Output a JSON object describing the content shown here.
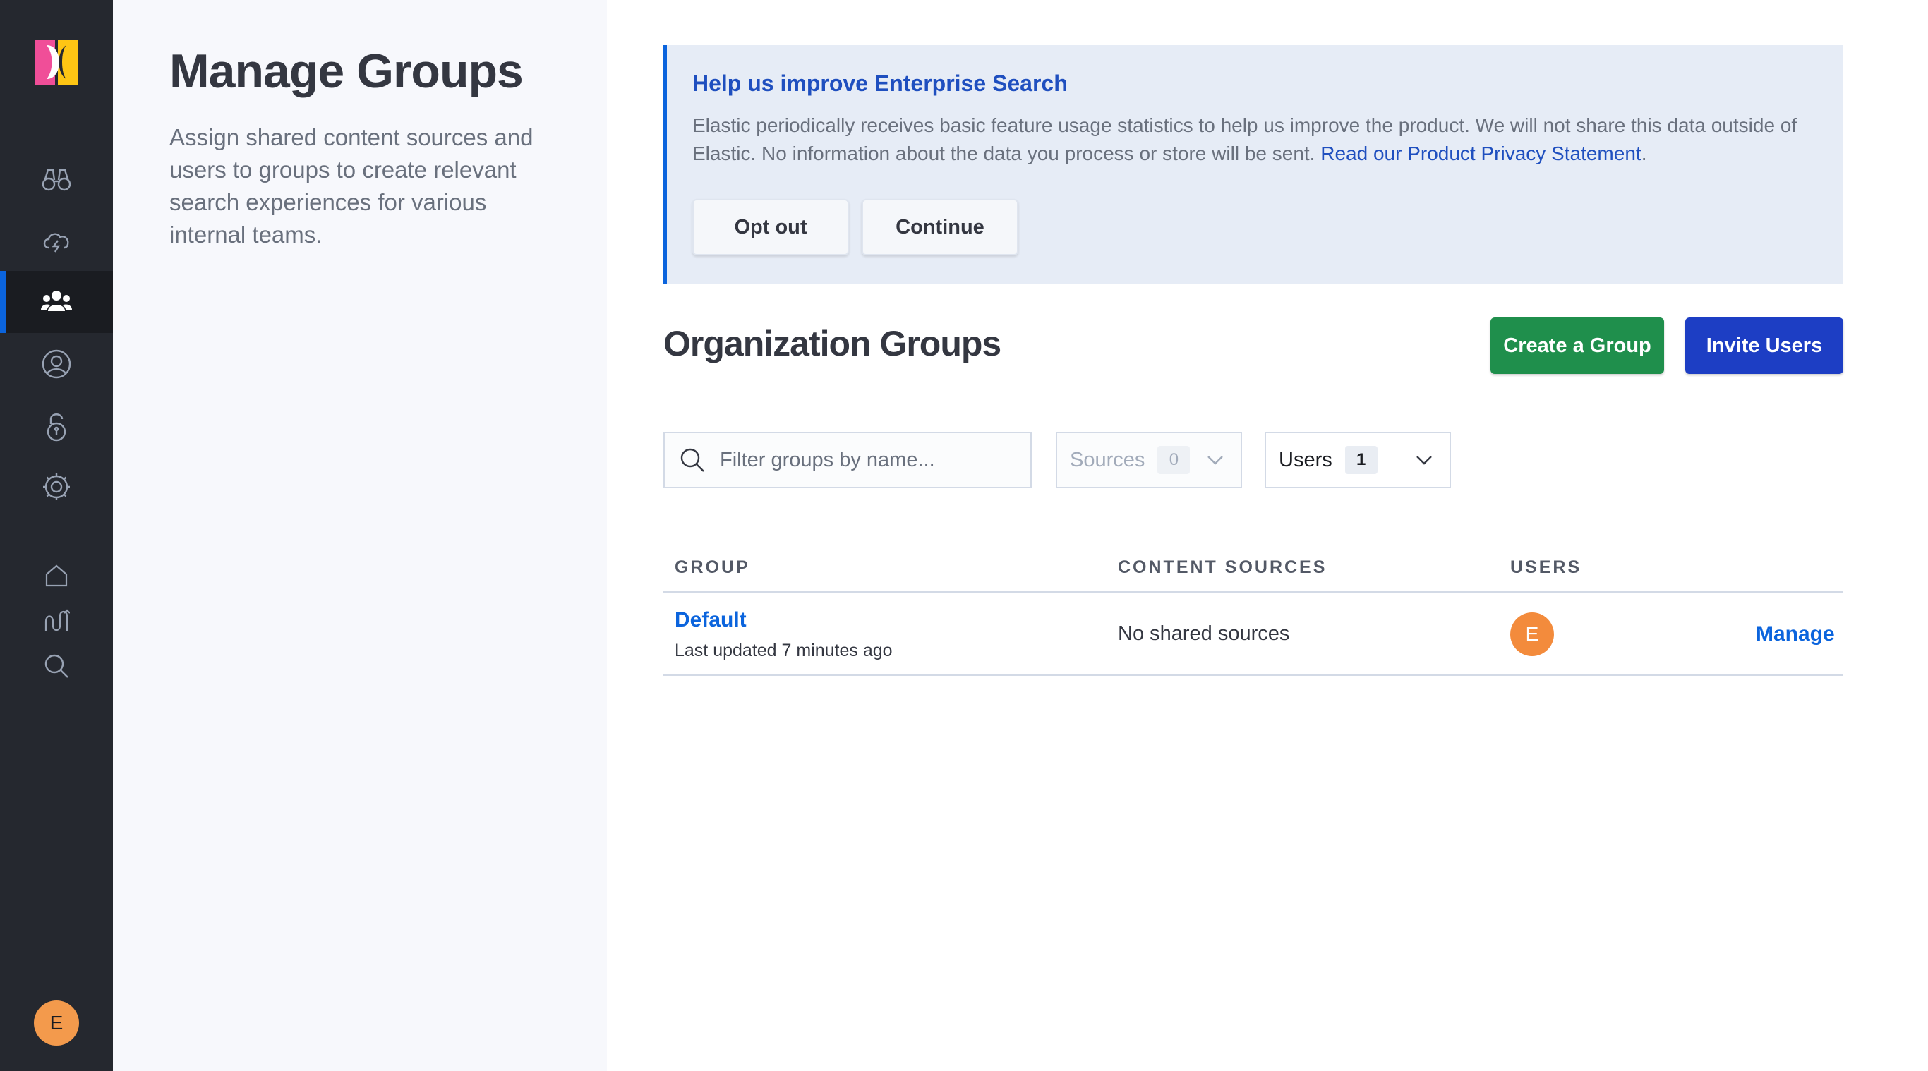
{
  "nav": {
    "logo": "workplace-search-logo",
    "items": [
      {
        "icon": "binoculars-icon"
      },
      {
        "icon": "cloud-lightning-icon"
      },
      {
        "icon": "users-icon",
        "active": true
      },
      {
        "icon": "user-circle-icon"
      },
      {
        "icon": "lock-icon"
      },
      {
        "icon": "gear-icon"
      },
      {
        "icon": "home-icon"
      },
      {
        "icon": "metrics-icon"
      },
      {
        "icon": "search-icon"
      }
    ],
    "avatar_initial": "E"
  },
  "side": {
    "title": "Manage Groups",
    "description": "Assign shared content sources and users to groups to create relevant search experiences for various internal teams."
  },
  "callout": {
    "title": "Help us improve Enterprise Search",
    "body": "Elastic periodically receives basic feature usage statistics to help us improve the product. We will not share this data outside of Elastic. No information about the data you process or store will be sent. ",
    "link": "Read our Product Privacy Statement",
    "link_suffix": ".",
    "opt_out_label": "Opt out",
    "continue_label": "Continue"
  },
  "main": {
    "title": "Organization Groups",
    "create_group_label": "Create a Group",
    "invite_users_label": "Invite Users"
  },
  "filters": {
    "search_placeholder": "Filter groups by name...",
    "sources": {
      "label": "Sources",
      "count": "0"
    },
    "users": {
      "label": "Users",
      "count": "1"
    }
  },
  "table": {
    "headers": {
      "group": "GROUP",
      "sources": "CONTENT SOURCES",
      "users": "USERS"
    },
    "rows": [
      {
        "name": "Default",
        "updated": "Last updated 7 minutes ago",
        "sources": "No shared sources",
        "user_initial": "E",
        "action": "Manage"
      }
    ]
  },
  "colors": {
    "nav_bg": "#25282f",
    "accent_blue": "#0b64dd",
    "primary_button": "#1d3ec4",
    "success_button": "#1f8f4c",
    "avatar": "#f38b3c",
    "callout_bg": "#e6ecf6"
  }
}
